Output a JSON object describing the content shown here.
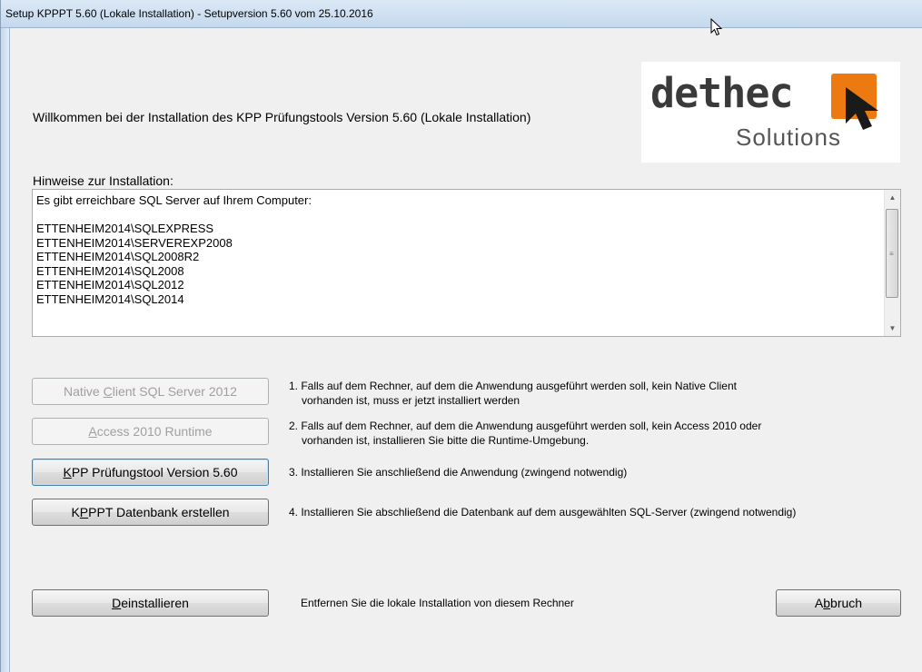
{
  "window": {
    "title": "Setup KPPPT 5.60 (Lokale Installation) - Setupversion 5.60 vom 25.10.2016"
  },
  "header": {
    "welcome": "Willkommen bei der Installation des KPP Prüfungstools Version 5.60 (Lokale Installation)",
    "logo": {
      "brand": "dethec",
      "sub": "Solutions",
      "accent": "#ec7a10"
    }
  },
  "hints": {
    "label": "Hinweise zur Installation:",
    "lines": [
      "Es gibt erreichbare SQL Server auf Ihrem Computer:",
      "",
      "ETTENHEIM2014\\SQLEXPRESS",
      "ETTENHEIM2014\\SERVEREXP2008",
      "ETTENHEIM2014\\SQL2008R2",
      "ETTENHEIM2014\\SQL2008",
      "ETTENHEIM2014\\SQL2012",
      "ETTENHEIM2014\\SQL2014"
    ]
  },
  "steps": [
    {
      "button": {
        "before": "Native ",
        "key": "C",
        "after": "lient SQL Server 2012"
      },
      "enabled": false,
      "desc1": "1. Falls auf dem Rechner, auf dem die Anwendung ausgeführt werden soll, kein Native Client",
      "desc2": "vorhanden ist, muss er jetzt installiert werden"
    },
    {
      "button": {
        "before": "",
        "key": "A",
        "after": "ccess 2010 Runtime"
      },
      "enabled": false,
      "desc1": "2. Falls auf dem Rechner, auf dem die Anwendung ausgeführt werden soll, kein Access 2010 oder",
      "desc2": "vorhanden ist, installieren Sie bitte die Runtime-Umgebung."
    },
    {
      "button": {
        "before": "",
        "key": "K",
        "after": "PP Prüfungstool Version 5.60"
      },
      "enabled": true,
      "desc1": "3. Installieren Sie anschließend die Anwendung (zwingend notwendig)",
      "desc2": ""
    },
    {
      "button": {
        "before": "K",
        "key": "P",
        "after": "PPT Datenbank erstellen"
      },
      "enabled": true,
      "desc1": "4. Installieren Sie abschließend die Datenbank auf dem ausgewählten SQL-Server (zwingend notwendig)",
      "desc2": ""
    }
  ],
  "footer": {
    "uninstall": {
      "before": "",
      "key": "D",
      "after": "einstallieren"
    },
    "uninstall_desc": "Entfernen Sie die lokale Installation von diesem Rechner",
    "cancel": {
      "before": "A",
      "key": "b",
      "after": "bruch"
    }
  }
}
